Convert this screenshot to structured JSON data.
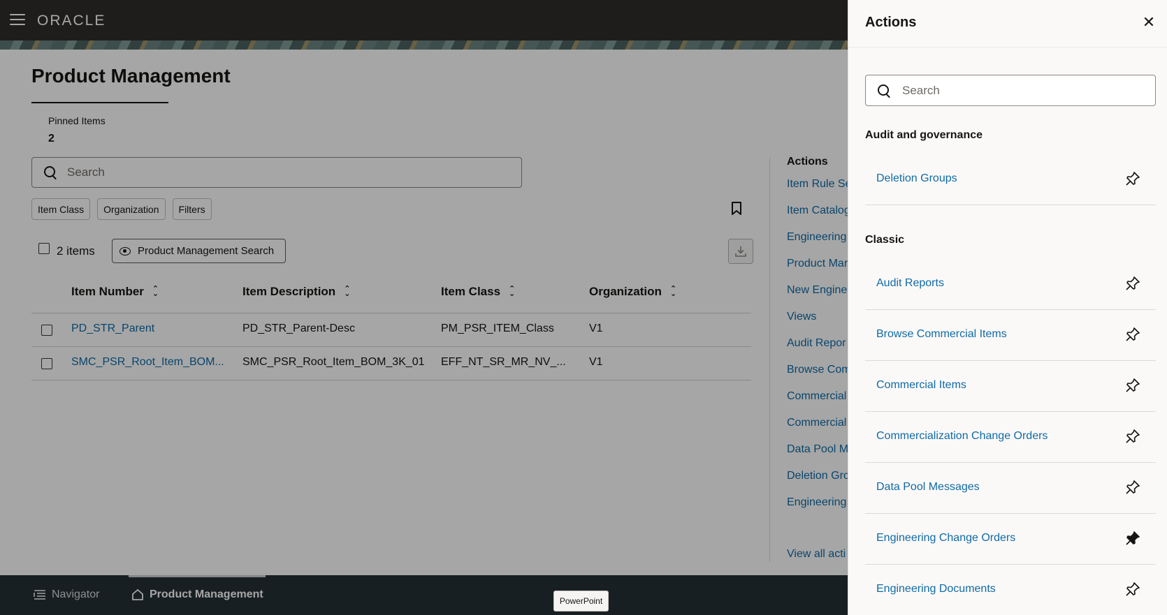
{
  "header": {
    "logo": "ORACLE"
  },
  "page": {
    "title": "Product Management",
    "pinned_label": "Pinned Items",
    "pinned_count": "2",
    "search_placeholder": "Search",
    "chips": [
      "Item Class",
      "Organization",
      "Filters"
    ],
    "items_count": "2 items",
    "saved_search_button": "Product Management Search"
  },
  "table": {
    "columns": [
      "Item Number",
      "Item Description",
      "Item Class",
      "Organization"
    ],
    "rows": [
      {
        "item_number": "PD_STR_Parent",
        "description": "PD_STR_Parent-Desc",
        "item_class": "PM_PSR_ITEM_Class",
        "organization": "V1"
      },
      {
        "item_number": "SMC_PSR_Root_Item_BOM...",
        "description": "SMC_PSR_Root_Item_BOM_3K_01",
        "item_class": "EFF_NT_SR_MR_NV_...",
        "organization": "V1"
      }
    ]
  },
  "page_actions": {
    "heading": "Actions",
    "links": [
      "Item Rule Se",
      "Item Catalog",
      "Engineering",
      "Product Mar",
      "New Engine",
      "Views",
      "Audit Repor",
      "Browse Com",
      "Commercial",
      "Commercial",
      "Data Pool M",
      "Deletion Gro",
      "Engineering"
    ],
    "view_all": "View all acti"
  },
  "bottom_bar": {
    "navigator": "Navigator",
    "product_management": "Product Management",
    "tooltip": "PowerPoint"
  },
  "drawer": {
    "title": "Actions",
    "search_placeholder": "Search",
    "sections": [
      {
        "heading": "Audit and governance",
        "items": [
          {
            "label": "Deletion Groups",
            "pinned": false
          }
        ]
      },
      {
        "heading": "Classic",
        "items": [
          {
            "label": "Audit Reports",
            "pinned": false
          },
          {
            "label": "Browse Commercial Items",
            "pinned": false
          },
          {
            "label": "Commercial Items",
            "pinned": false
          },
          {
            "label": "Commercialization Change Orders",
            "pinned": false
          },
          {
            "label": "Data Pool Messages",
            "pinned": false
          },
          {
            "label": "Engineering Change Orders",
            "pinned": true
          },
          {
            "label": "Engineering Documents",
            "pinned": false
          }
        ]
      }
    ]
  },
  "colors": {
    "header_bg": "#312d2a",
    "link": "#0f6ba6",
    "bottom_bar_bg": "#263135",
    "drawer_bg": "#fbf9f8"
  }
}
